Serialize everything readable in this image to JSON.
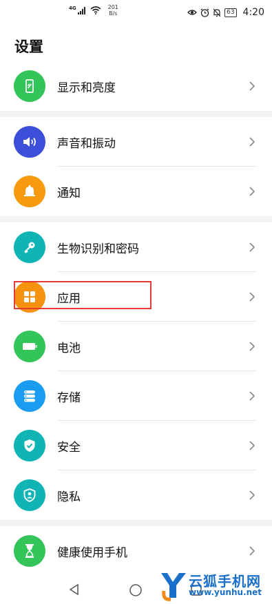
{
  "status_bar": {
    "network": "4G",
    "speed_value": "201",
    "speed_unit": "B/s",
    "battery": "63",
    "time": "4:20"
  },
  "page": {
    "title": "设置"
  },
  "groups": [
    {
      "items": [
        {
          "label": "显示和亮度",
          "icon": "display-icon",
          "color": "#34c55a"
        }
      ]
    },
    {
      "items": [
        {
          "label": "声音和振动",
          "icon": "speaker-icon",
          "color": "#3b4fd8"
        },
        {
          "label": "通知",
          "icon": "bell-icon",
          "color": "#f79a0e"
        }
      ]
    },
    {
      "items": [
        {
          "label": "生物识别和密码",
          "icon": "key-icon",
          "color": "#11b4b4"
        },
        {
          "label": "应用",
          "icon": "apps-grid-icon",
          "color": "#f7920f"
        },
        {
          "label": "电池",
          "icon": "battery-icon",
          "color": "#34c55a"
        },
        {
          "label": "存储",
          "icon": "storage-icon",
          "color": "#1a9cf0"
        },
        {
          "label": "安全",
          "icon": "shield-check-icon",
          "color": "#11b4b4"
        },
        {
          "label": "隐私",
          "icon": "privacy-shield-icon",
          "color": "#11b4b4"
        }
      ]
    },
    {
      "items": [
        {
          "label": "健康使用手机",
          "icon": "hourglass-icon",
          "color": "#34c55a"
        }
      ]
    }
  ],
  "highlight_color": "#e53935",
  "watermark": {
    "title": "云狐手机网",
    "url": "www.yunhu.net"
  }
}
